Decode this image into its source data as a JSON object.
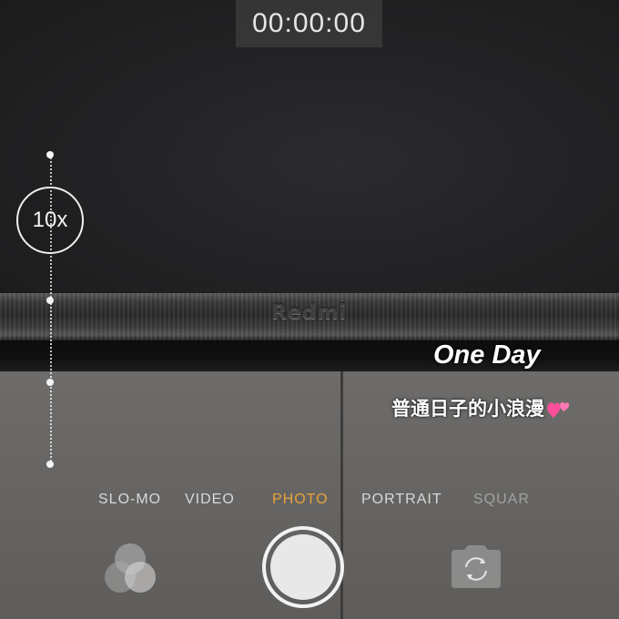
{
  "recording": {
    "timer": "00:00:00"
  },
  "zoom": {
    "level_label": "10x"
  },
  "background": {
    "tv_brand": "Redmi"
  },
  "caption": {
    "title": "One Day",
    "subtitle": "普通日子的小浪漫",
    "emoji_icon": "two-hearts-icon"
  },
  "camera_modes": [
    {
      "label": "SLO-MO",
      "active": false
    },
    {
      "label": "VIDEO",
      "active": false
    },
    {
      "label": "PHOTO",
      "active": true
    },
    {
      "label": "PORTRAIT",
      "active": false
    },
    {
      "label": "SQUARE",
      "active": false
    }
  ],
  "controls": {
    "filters_icon": "filters-icon",
    "shutter_icon": "shutter-icon",
    "flip_icon": "camera-flip-icon"
  },
  "colors": {
    "active_mode": "#e8a33c",
    "caption_heart": "#ff4f9a"
  }
}
